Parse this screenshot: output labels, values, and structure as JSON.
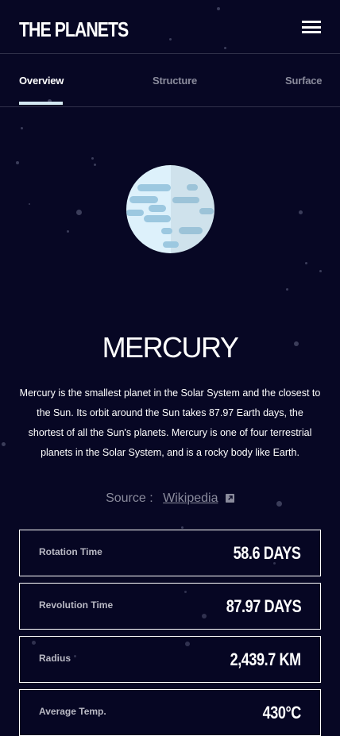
{
  "header": {
    "logo": "THE PLANETS",
    "menu_icon": "hamburger-menu-icon"
  },
  "tabs": [
    {
      "label": "Overview",
      "active": true
    },
    {
      "label": "Structure",
      "active": false
    },
    {
      "label": "Surface",
      "active": false
    }
  ],
  "planet": {
    "name": "MERCURY",
    "image_icon": "mercury-planet-icon",
    "description": "Mercury is the smallest planet in the Solar System and the closest to the Sun. Its orbit around the Sun takes 87.97 Earth days, the shortest of all the Sun's planets. Mercury is one of four terrestrial planets in the Solar System, and is a rocky body like Earth.",
    "source_label": "Source :",
    "source_link": "Wikipedia",
    "source_icon": "external-link-icon"
  },
  "stats": [
    {
      "label": "Rotation Time",
      "value": "58.6 DAYS"
    },
    {
      "label": "Revolution Time",
      "value": "87.97 DAYS"
    },
    {
      "label": "Radius",
      "value": "2,439.7 KM"
    },
    {
      "label": "Average Temp.",
      "value": "430°C"
    }
  ],
  "colors": {
    "background": "#070724",
    "accent": "#d3e8f2",
    "muted": "#8a8b9c",
    "border": "#2f3049"
  }
}
